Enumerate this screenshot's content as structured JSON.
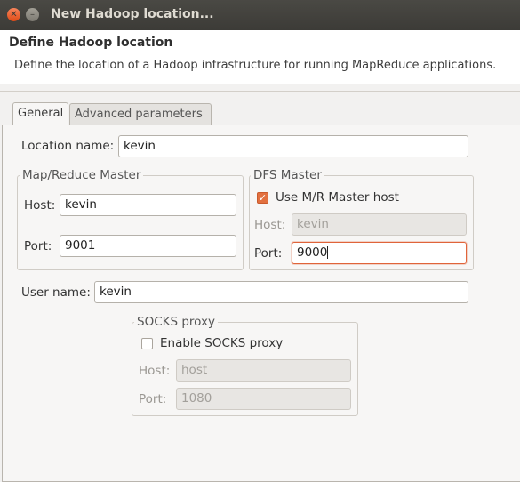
{
  "window": {
    "title": "New Hadoop location..."
  },
  "header": {
    "title": "Define Hadoop location",
    "description": "Define the location of a Hadoop infrastructure for running MapReduce applications."
  },
  "tabs": [
    {
      "label": "General",
      "active": true
    },
    {
      "label": "Advanced parameters",
      "active": false
    }
  ],
  "general": {
    "location_name_label": "Location name:",
    "location_name_value": "kevin",
    "mapreduce_master": {
      "title": "Map/Reduce Master",
      "host_label": "Host:",
      "host_value": "kevin",
      "port_label": "Port:",
      "port_value": "9001"
    },
    "dfs_master": {
      "title": "DFS Master",
      "use_mr_host_label": "Use M/R Master host",
      "use_mr_host_checked": true,
      "host_label": "Host:",
      "host_value": "kevin",
      "port_label": "Port:",
      "port_value": "9000"
    },
    "user_name_label": "User name:",
    "user_name_value": "kevin",
    "socks_proxy": {
      "title": "SOCKS proxy",
      "enable_label": "Enable SOCKS proxy",
      "enable_checked": false,
      "host_label": "Host:",
      "host_value": "host",
      "port_label": "Port:",
      "port_value": "1080"
    }
  },
  "colors": {
    "accent": "#e0643a",
    "titlebar": "#3c3b37"
  }
}
